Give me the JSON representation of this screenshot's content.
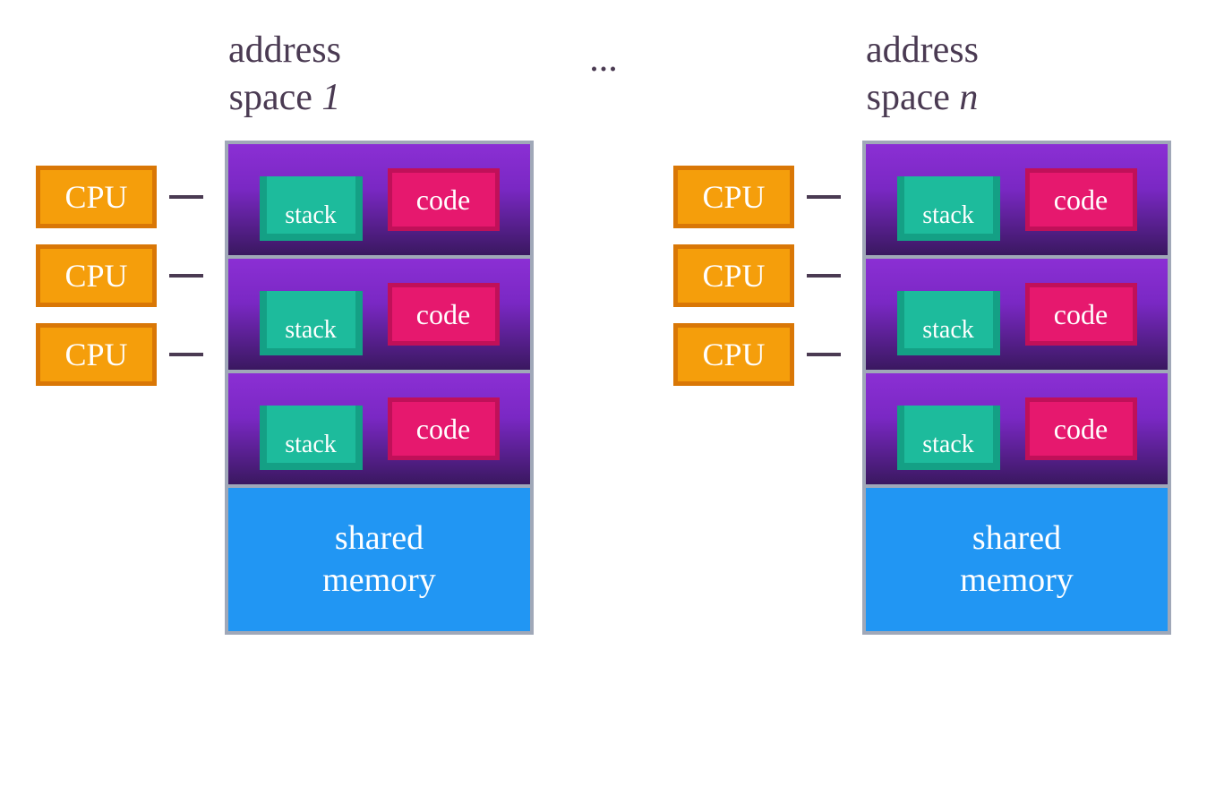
{
  "ellipsis": "...",
  "address_spaces": [
    {
      "title_line1": "address",
      "title_line2_prefix": "space ",
      "title_line2_num": "1",
      "threads": [
        {
          "cpu": "CPU",
          "stack": "stack",
          "code": "code"
        },
        {
          "cpu": "CPU",
          "stack": "stack",
          "code": "code"
        },
        {
          "cpu": "CPU",
          "stack": "stack",
          "code": "code"
        }
      ],
      "shared_line1": "shared",
      "shared_line2": "memory"
    },
    {
      "title_line1": "address",
      "title_line2_prefix": "space ",
      "title_line2_num": "n",
      "threads": [
        {
          "cpu": "CPU",
          "stack": "stack",
          "code": "code"
        },
        {
          "cpu": "CPU",
          "stack": "stack",
          "code": "code"
        },
        {
          "cpu": "CPU",
          "stack": "stack",
          "code": "code"
        }
      ],
      "shared_line1": "shared",
      "shared_line2": "memory"
    }
  ],
  "colors": {
    "cpu_bg": "#f59e0b",
    "cpu_border": "#d97706",
    "thread_bg_top": "#8b2fd4",
    "thread_bg_bottom": "#3a1860",
    "stack_bg": "#1dbb9c",
    "stack_border": "#14a085",
    "code_bg": "#e6186e",
    "code_border": "#c01059",
    "shared_bg": "#2196f3",
    "frame_border": "#a0a8b8",
    "text": "#4a3a52"
  }
}
